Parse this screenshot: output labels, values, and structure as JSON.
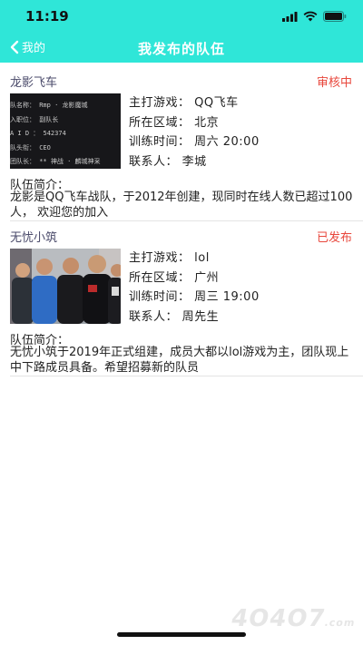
{
  "status_bar": {
    "time": "11:19"
  },
  "nav": {
    "back_label": "我的",
    "title": "我发布的队伍"
  },
  "colors": {
    "header": "#2fe6d8",
    "status_red": "#e8473c"
  },
  "teams": [
    {
      "name": "龙影飞车",
      "status": "审核中",
      "game": "主打游戏：  QQ飞车",
      "region": "所在区域：  北京",
      "training": "训练时间：  周六 20:00",
      "contact": "联系人：  李城",
      "desc_label": "队伍简介：",
      "desc": "龙影是QQ飞车战队，于2012年创建，现同时在线人数已超过100人，  欢迎您的加入",
      "thumb_lines": [
        "队名称：  Rmp · 龙影魔城",
        "入职位：  副队长",
        "A I D ：  542374",
        "队头衔：  CEO",
        "团队长：  ** 神战 · 麟城神采"
      ]
    },
    {
      "name": "无忧小筑",
      "status": "已发布",
      "game": "主打游戏：  lol",
      "region": "所在区域：  广州",
      "training": "训练时间：  周三 19:00",
      "contact": "联系人：  周先生",
      "desc_label": "队伍简介：",
      "desc": "无忧小筑于2019年正式组建，成员大都以lol游戏为主，团队现上中下路成员具备。希望招募新的队员"
    }
  ],
  "watermark": {
    "text": "4O4O7",
    "suffix": ".com"
  }
}
